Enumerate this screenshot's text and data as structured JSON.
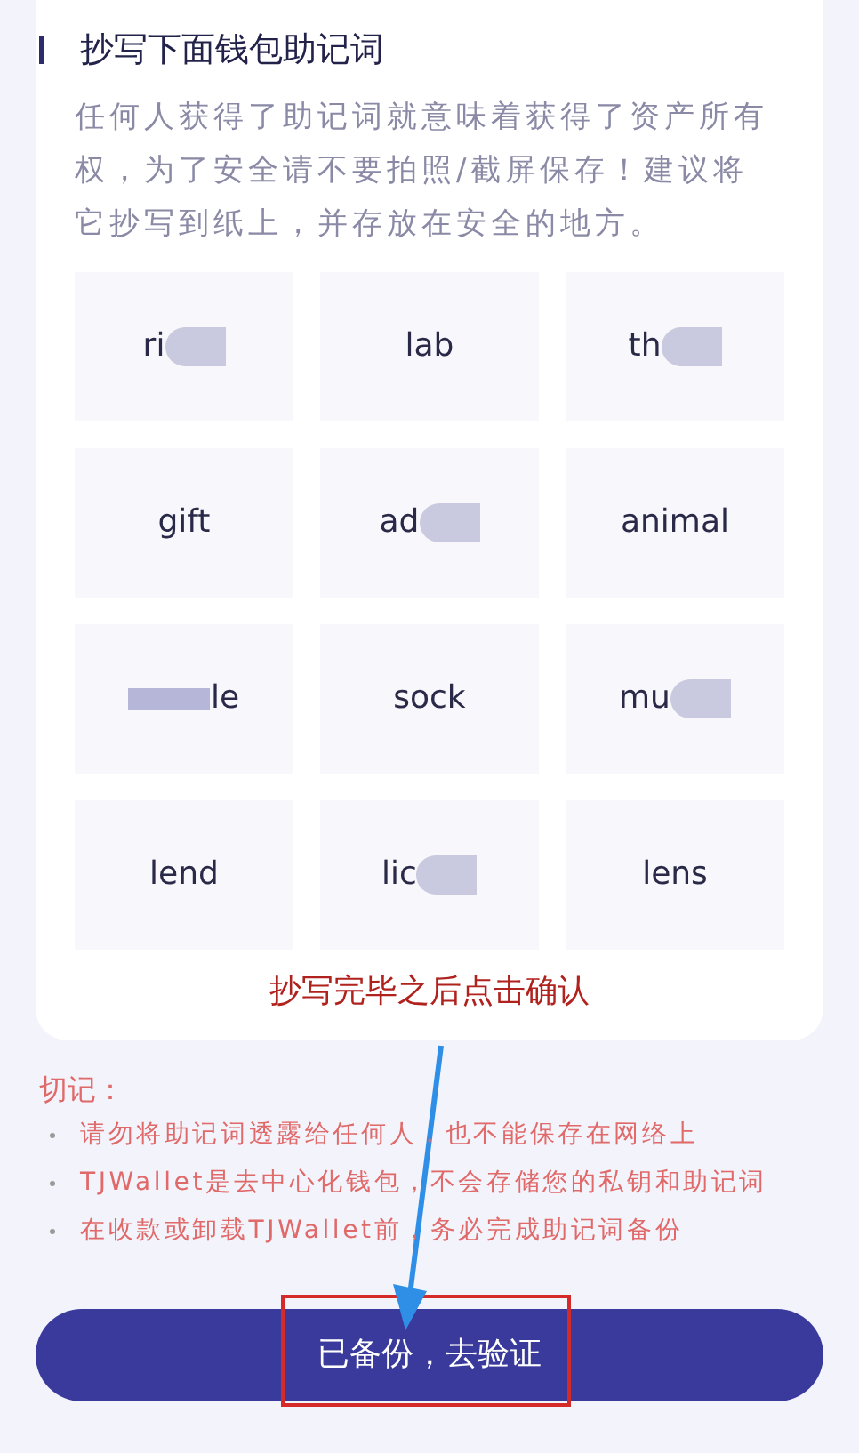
{
  "title": "抄写下面钱包助记词",
  "description": "任何人获得了助记词就意味着获得了资产所有权，为了安全请不要拍照/截屏保存！建议将它抄写到纸上，并存放在安全的地方。",
  "words": [
    {
      "text": "ri",
      "blur_before": false,
      "blur_after": true
    },
    {
      "text": "lab",
      "blur_before": false,
      "blur_after": false
    },
    {
      "text": "th",
      "blur_before": false,
      "blur_after": true
    },
    {
      "text": "gift",
      "blur_before": false,
      "blur_after": false
    },
    {
      "text": "ad",
      "blur_before": false,
      "blur_after": true
    },
    {
      "text": "animal",
      "blur_before": false,
      "blur_after": false
    },
    {
      "text": "le",
      "blur_before": true,
      "blur_after": false
    },
    {
      "text": "sock",
      "blur_before": false,
      "blur_after": false
    },
    {
      "text": "mu",
      "blur_before": false,
      "blur_after": true
    },
    {
      "text": "lend",
      "blur_before": false,
      "blur_after": false
    },
    {
      "text": "lic",
      "blur_before": false,
      "blur_after": true
    },
    {
      "text": "lens",
      "blur_before": false,
      "blur_after": false
    }
  ],
  "annotation": "抄写完毕之后点击确认",
  "warning_title": "切记：",
  "warnings": [
    "请勿将助记词透露给任何人，也不能保存在网络上",
    "TJWallet是去中心化钱包，不会存储您的私钥和助记词",
    "在收款或卸载TJWallet前，务必完成助记词备份"
  ],
  "button": "已备份，去验证"
}
